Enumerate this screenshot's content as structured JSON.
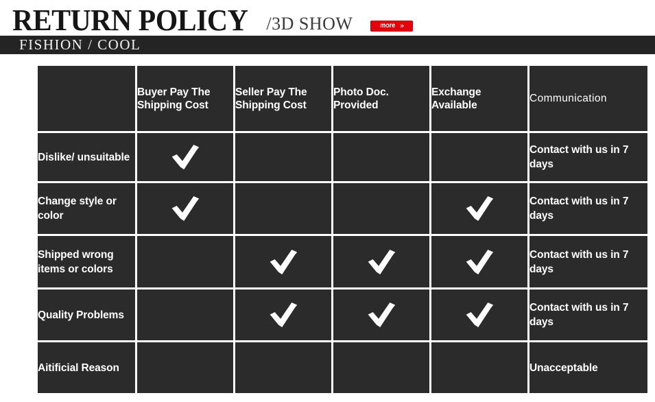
{
  "banner": {
    "main_title": "RETURN POLICY",
    "sub_title": "/3D SHOW",
    "more_label": "more",
    "more_chevron": "»",
    "band_text": "FISHION / COOL",
    "accent_color": "#e2010d",
    "band_color": "#242424"
  },
  "table": {
    "corner_label": "",
    "headers": [
      "Buyer Pay The Shipping Cost",
      "Seller Pay The Shipping Cost",
      "Photo Doc. Provided",
      "Exchange Available",
      "Communication"
    ],
    "rows": [
      {
        "label": "Dislike/ unsuitable",
        "buyer_pay": "check",
        "seller_pay": "",
        "photo_doc": "",
        "exchange": "",
        "communication": "Contact with us in 7 days"
      },
      {
        "label": "Change style or color",
        "buyer_pay": "check",
        "seller_pay": "",
        "photo_doc": "",
        "exchange": "check",
        "communication": "Contact with us in 7 days"
      },
      {
        "label": "Shipped wrong items or colors",
        "buyer_pay": "",
        "seller_pay": "check",
        "photo_doc": "check",
        "exchange": "check",
        "communication": "Contact with us in 7 days"
      },
      {
        "label": "Quality Problems",
        "buyer_pay": "",
        "seller_pay": "check",
        "photo_doc": "check",
        "exchange": "check",
        "communication": "Contact with us in 7 days"
      },
      {
        "label": "Aitificial Reason",
        "buyer_pay": "",
        "seller_pay": "",
        "photo_doc": "",
        "exchange": "",
        "communication": "Unacceptable"
      }
    ]
  }
}
